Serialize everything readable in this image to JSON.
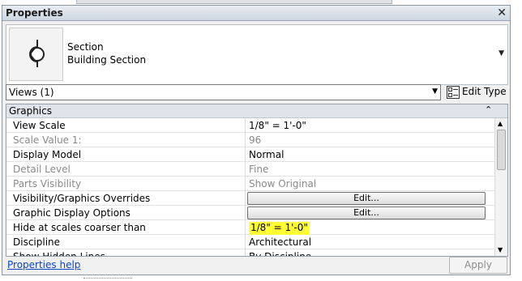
{
  "window": {
    "title": "Properties",
    "close_glyph": "✕"
  },
  "type_selector": {
    "icon": "section-marker-icon",
    "family": "Section",
    "type": "Building Section"
  },
  "instance_filter": {
    "value": "Views (1)"
  },
  "edit_type": {
    "label": "Edit Type",
    "icon": "edit-type-icon"
  },
  "group": {
    "label": "Graphics"
  },
  "rows": [
    {
      "name": "View Scale",
      "value": "1/8\" = 1'-0\""
    },
    {
      "name": "Scale Value    1:",
      "value": "96"
    },
    {
      "name": "Display Model",
      "value": "Normal"
    },
    {
      "name": "Detail Level",
      "value": "Fine"
    },
    {
      "name": "Parts Visibility",
      "value": "Show Original"
    },
    {
      "name": "Visibility/Graphics Overrides",
      "value": "Edit..."
    },
    {
      "name": "Graphic Display Options",
      "value": "Edit..."
    },
    {
      "name": "Hide at scales coarser than",
      "value": "1/8\" = 1'-0\""
    },
    {
      "name": "Discipline",
      "value": "Architectural"
    },
    {
      "name": "Show Hidden Lines",
      "value": "By Discipline"
    }
  ],
  "footer": {
    "help": "Properties help",
    "apply": "Apply"
  },
  "colors": {
    "highlight": "#ffff33",
    "link": "#0b45c8",
    "disabled_text": "#8a8a8a"
  }
}
